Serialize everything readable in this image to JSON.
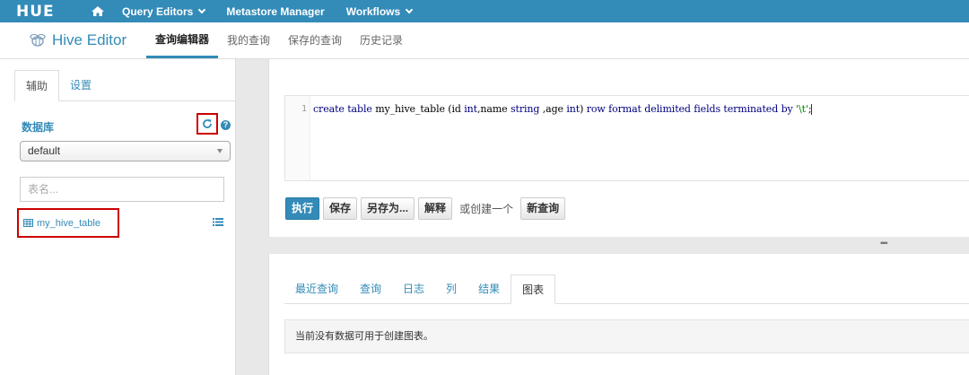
{
  "topnav": {
    "logo": "HUE",
    "items": [
      {
        "label": "Query Editors",
        "has_caret": true
      },
      {
        "label": "Metastore Manager",
        "has_caret": false
      },
      {
        "label": "Workflows",
        "has_caret": true
      }
    ],
    "bg_color": "#338bb8"
  },
  "subbar": {
    "brand": "Hive Editor",
    "tabs": [
      {
        "label": "查询编辑器",
        "active": true
      },
      {
        "label": "我的查询",
        "active": false
      },
      {
        "label": "保存的查询",
        "active": false
      },
      {
        "label": "历史记录",
        "active": false
      }
    ]
  },
  "sidebar": {
    "tabs": [
      {
        "label": "辅助",
        "active": true
      },
      {
        "label": "设置",
        "active": false
      }
    ],
    "database_label": "数据库",
    "database_selected": "default",
    "table_search_placeholder": "表名...",
    "tables": [
      {
        "name": "my_hive_table"
      }
    ],
    "icons": {
      "refresh": "refresh-icon",
      "help": "help-icon",
      "table": "table-icon",
      "list": "list-icon"
    },
    "highlight_color": "#cc0000"
  },
  "editor": {
    "line_number": "1",
    "query": "create table my_hive_table (id int,name string ,age int) row format delimited fields terminated by '\\t';",
    "buttons": {
      "execute": "执行",
      "save": "保存",
      "save_as": "另存为...",
      "explain": "解释",
      "or_create": "或创建一个",
      "new_query": "新查询"
    }
  },
  "results": {
    "tabs": [
      {
        "label": "最近查询",
        "active": false
      },
      {
        "label": "查询",
        "active": false
      },
      {
        "label": "日志",
        "active": false
      },
      {
        "label": "列",
        "active": false
      },
      {
        "label": "结果",
        "active": false
      },
      {
        "label": "图表",
        "active": true
      }
    ],
    "message": "当前没有数据可用于创建图表。"
  }
}
